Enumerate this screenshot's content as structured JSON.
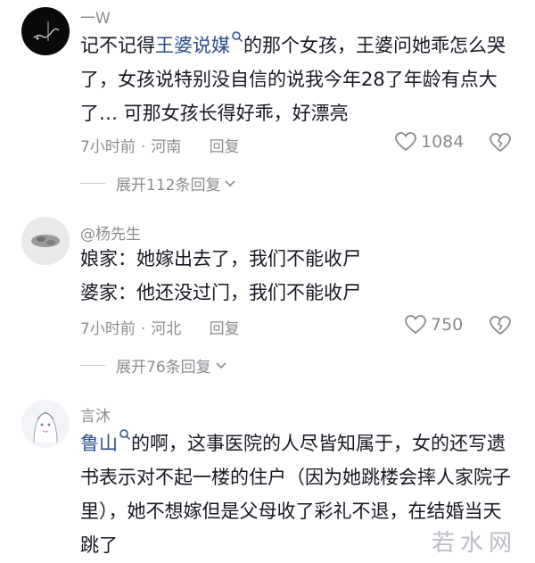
{
  "comments": [
    {
      "username": "一W",
      "mention": "王婆说媒",
      "text_before": "记不记得",
      "text_after": "的那个女孩，王婆问她乖怎么哭了，女孩说特别没自信的说我今年28了年龄有点大了… 可那女孩长得好乖，好漂亮",
      "time": "7小时前",
      "location": "河南",
      "reply_label": "回复",
      "likes": "1084",
      "expand_label": "展开112条回复"
    },
    {
      "username": "@杨先生",
      "lines": [
        "娘家：她嫁出去了，我们不能收尸",
        "婆家：他还没过门，我们不能收尸"
      ],
      "time": "7小时前",
      "location": "河北",
      "reply_label": "回复",
      "likes": "750",
      "expand_label": "展开76条回复"
    },
    {
      "username": "言沐",
      "mention": "鲁山",
      "text_after": "的啊，这事医院的人尽皆知属于，女的还写遗书表示对不起一楼的住户（因为她跳楼会摔人家院子里），她不想嫁但是父母收了彩礼不退，在结婚当天跳了"
    }
  ],
  "watermark": "若水网",
  "icons": {
    "like": "heart-outline-icon",
    "dislike": "broken-heart-icon",
    "expand": "chevron-down-icon",
    "mention": "search-icon"
  }
}
